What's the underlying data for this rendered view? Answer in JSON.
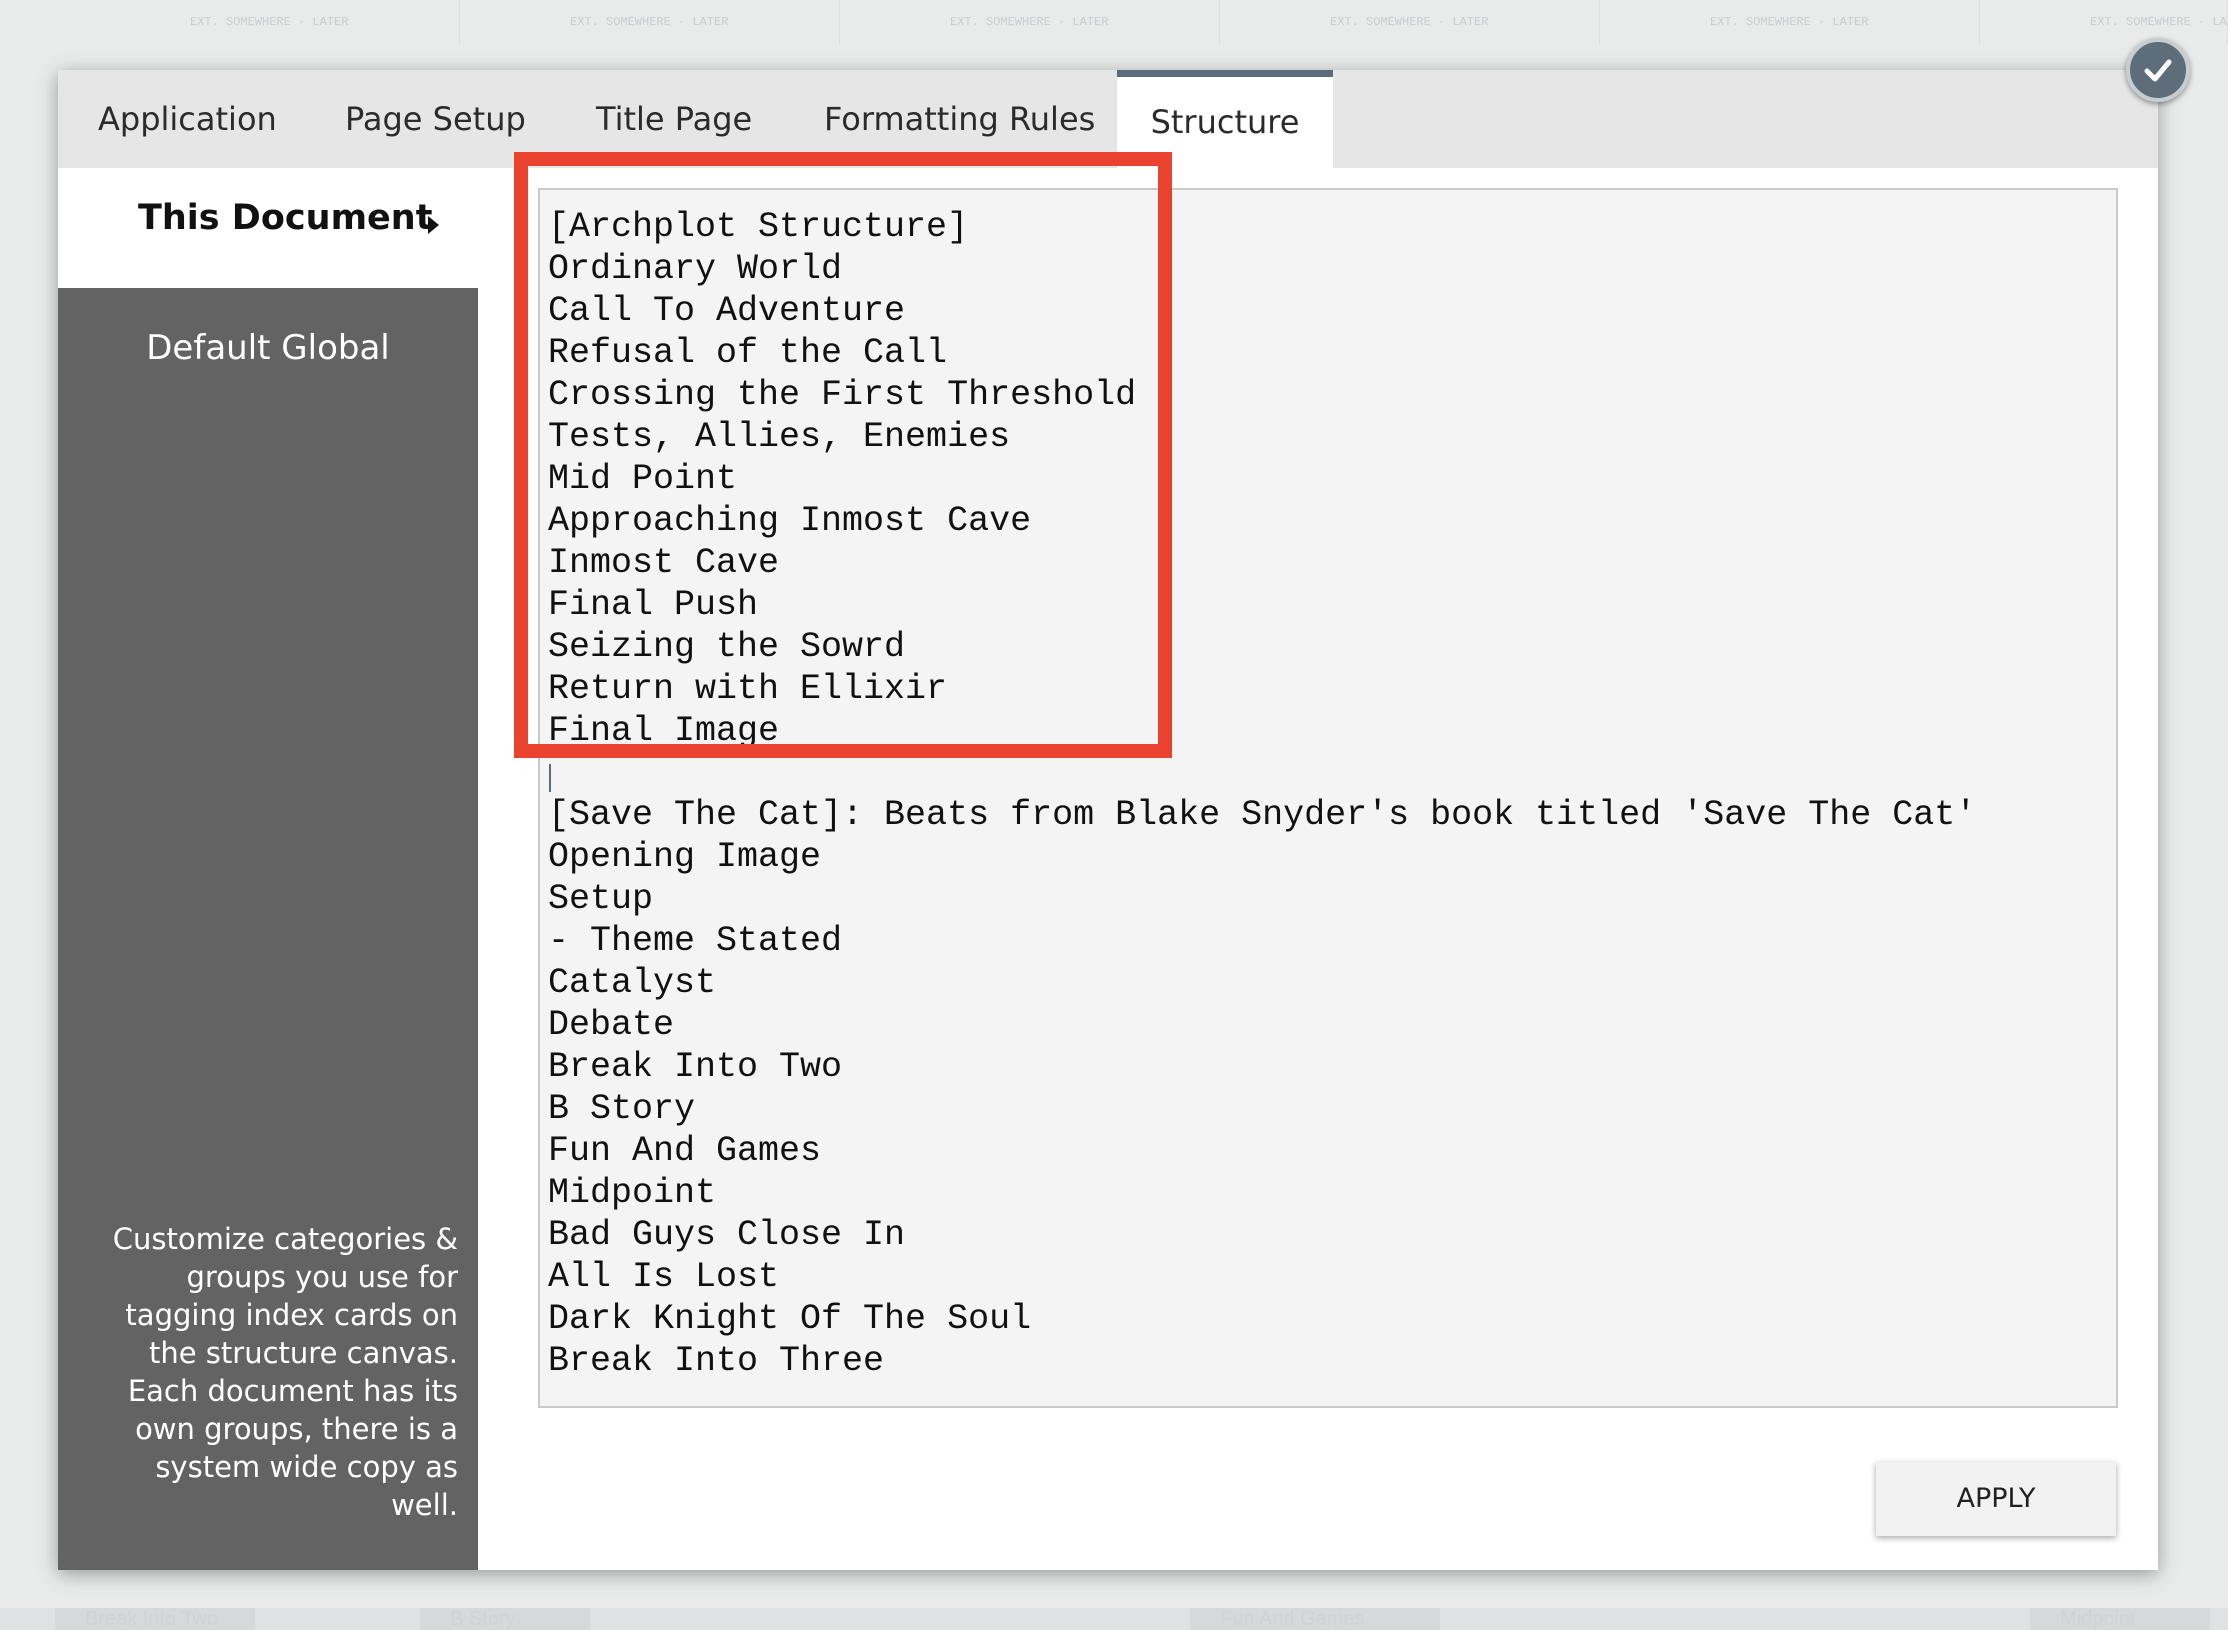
{
  "tabs": [
    {
      "label": "Application"
    },
    {
      "label": "Page Setup"
    },
    {
      "label": "Title Page"
    },
    {
      "label": "Formatting Rules"
    },
    {
      "label": "Structure"
    }
  ],
  "active_tab": "Structure",
  "sidebar": {
    "active_item": "This Document",
    "items": [
      {
        "label": "Default Global"
      }
    ],
    "help_text": "Customize categories & groups you use for tagging index cards on the structure canvas. Each document has its own groups, there is a system wide copy as well."
  },
  "editor": {
    "lines": [
      "[Archplot Structure]",
      "Ordinary World",
      "Call To Adventure",
      "Refusal of the Call",
      "Crossing the First Threshold",
      "Tests, Allies, Enemies",
      "Mid Point",
      "Approaching Inmost Cave",
      "Inmost Cave",
      "Final Push",
      "Seizing the Sowrd",
      "Return with Ellixir",
      "Final Image",
      "",
      "[Save The Cat]: Beats from Blake Snyder's book titled 'Save The Cat'",
      "Opening Image",
      "Setup",
      "- Theme Stated",
      "Catalyst",
      "Debate",
      "Break Into Two",
      "B Story",
      "Fun And Games",
      "Midpoint",
      "Bad Guys Close In",
      "All Is Lost",
      "Dark Knight Of The Soul",
      "Break Into Three"
    ]
  },
  "apply_label": "APPLY",
  "icons": {
    "confirm": "check-icon",
    "sidebar_expand": "caret-right-icon"
  },
  "colors": {
    "highlight": "#e94330",
    "sidebar_bg": "#636363",
    "active_tab_accent": "#586c7c",
    "badge": "#5d6e7a"
  },
  "background": {
    "cards": [
      "EXT. SOMEWHERE - LATER",
      "EXT. SOMEWHERE - LATER",
      "EXT. SOMEWHERE - LATER",
      "EXT. SOMEWHERE - LATER",
      "EXT. SOMEWHERE - LATER",
      "EXT. SOMEWHERE - LATER"
    ],
    "bottom_items": [
      "Break Into Two",
      "B Story",
      "Fun And Games",
      "Midpoint"
    ]
  }
}
